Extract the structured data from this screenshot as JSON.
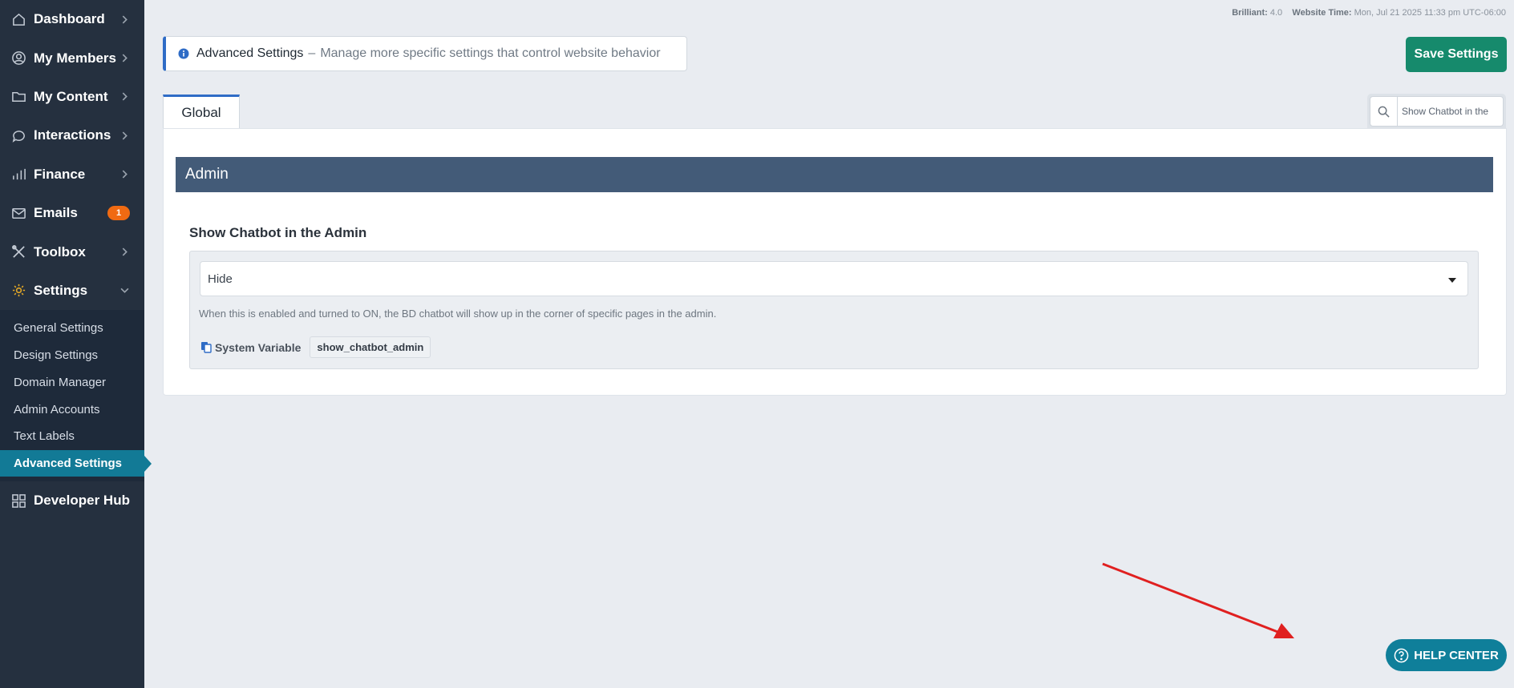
{
  "sidebar": {
    "items": [
      {
        "label": "Dashboard",
        "icon": "home-icon"
      },
      {
        "label": "My Members",
        "icon": "user-circle-icon"
      },
      {
        "label": "My Content",
        "icon": "folder-icon"
      },
      {
        "label": "Interactions",
        "icon": "chat-bubble-icon"
      },
      {
        "label": "Finance",
        "icon": "bar-chart-icon"
      },
      {
        "label": "Emails",
        "icon": "envelope-icon",
        "badge": "1"
      },
      {
        "label": "Toolbox",
        "icon": "tools-icon"
      },
      {
        "label": "Settings",
        "icon": "gear-icon"
      }
    ],
    "settings_sub": [
      {
        "label": "General Settings"
      },
      {
        "label": "Design Settings"
      },
      {
        "label": "Domain Manager"
      },
      {
        "label": "Admin Accounts"
      },
      {
        "label": "Text Labels"
      },
      {
        "label": "Advanced Settings",
        "active": true
      }
    ],
    "developer_hub": {
      "label": "Developer Hub",
      "icon": "grid-icon"
    }
  },
  "topmeta": {
    "version_label": "Brilliant:",
    "version_value": "4.0",
    "time_label": "Website Time:",
    "time_value": "Mon, Jul 21 2025 11:33 pm UTC-06:00"
  },
  "header": {
    "title": "Advanced Settings",
    "separator": "–",
    "description": "Manage more specific settings that control website behavior"
  },
  "save_button": "Save Settings",
  "tabs": [
    {
      "label": "Global"
    }
  ],
  "search": {
    "value": "Show Chatbot in the"
  },
  "section": {
    "title": "Admin"
  },
  "setting": {
    "title": "Show Chatbot in the Admin",
    "selected": "Hide",
    "help": "When this is enabled and turned to ON, the BD chatbot will show up in the corner of specific pages in the admin.",
    "sysvar_label": "System Variable",
    "sysvar_value": "show_chatbot_admin"
  },
  "help_center": "HELP CENTER",
  "colors": {
    "sidebar_bg": "#25303f",
    "accent_blue": "#2f6cc6",
    "save_green": "#168a6c",
    "section_header": "#435b78",
    "active_teal": "#127a96",
    "badge_orange": "#f06a12",
    "annotation_red": "#e02020"
  }
}
